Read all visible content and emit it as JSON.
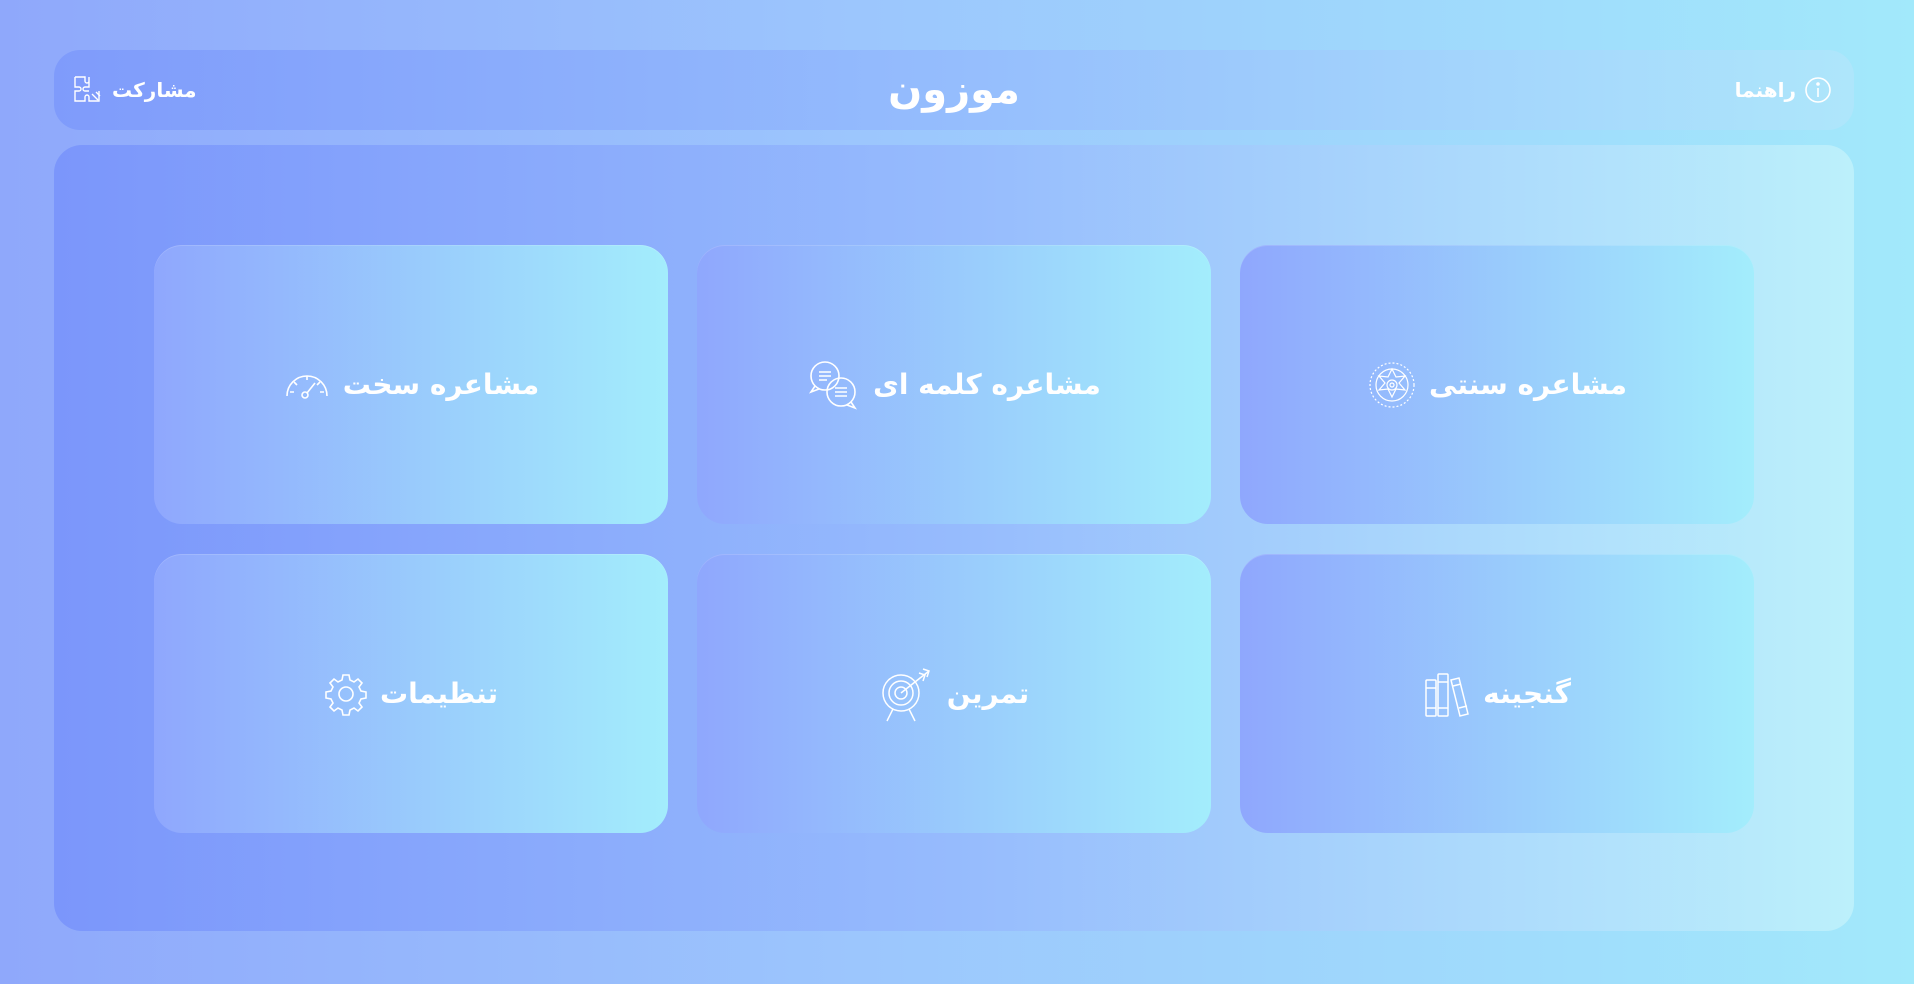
{
  "header": {
    "title": "موزون",
    "share_label": "مشارکت",
    "share_icon": "puzzle-icon",
    "help_label": "راهنما",
    "help_icon": "info-icon"
  },
  "menu": {
    "cards": [
      {
        "label": "مشاعره سخت",
        "icon": "speedometer-icon"
      },
      {
        "label": "مشاعره کلمه ای",
        "icon": "chat-bubbles-icon"
      },
      {
        "label": "مشاعره سنتی",
        "icon": "ornament-icon"
      },
      {
        "label": "تنظیمات",
        "icon": "gear-icon"
      },
      {
        "label": "تمرین",
        "icon": "target-icon"
      },
      {
        "label": "گنجینه",
        "icon": "books-icon"
      }
    ]
  }
}
